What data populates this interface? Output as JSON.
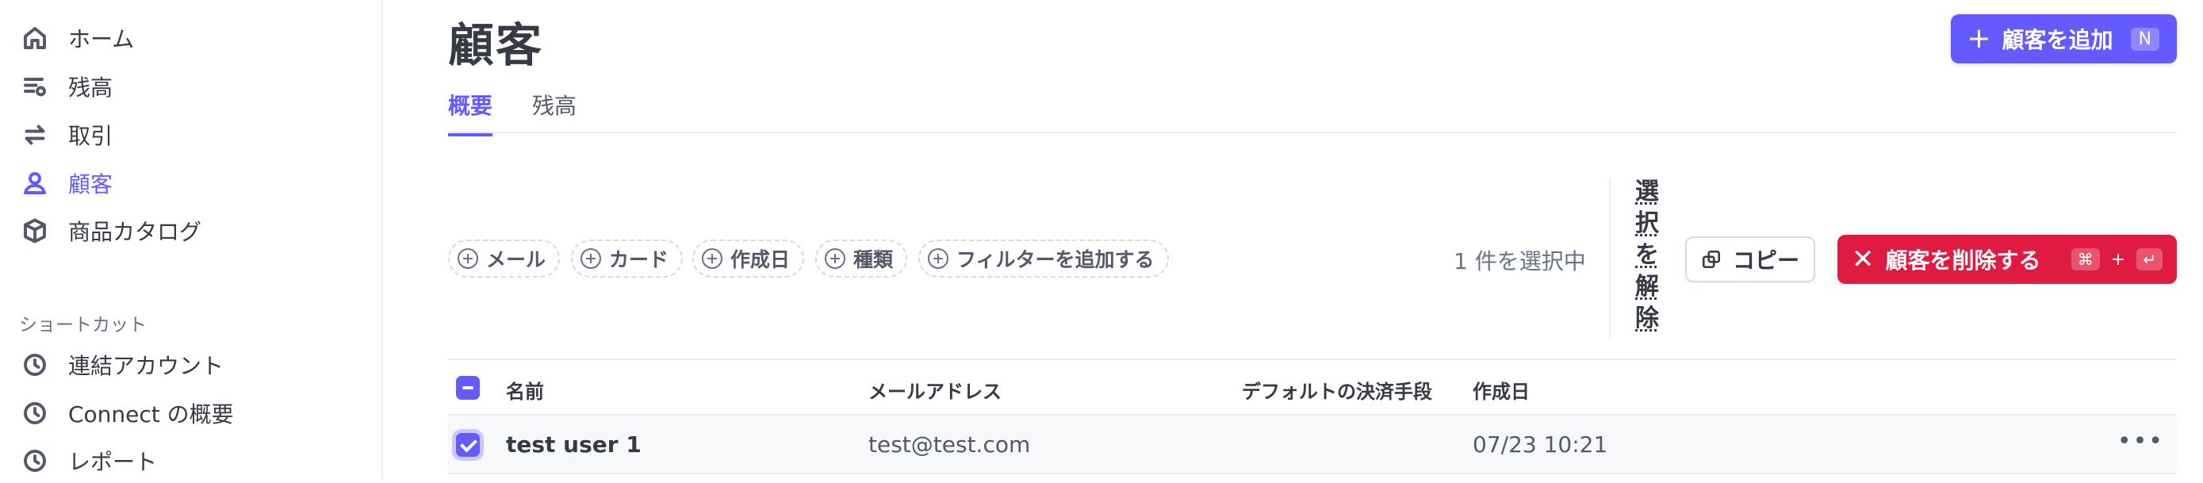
{
  "sidebar": {
    "items": [
      {
        "label": "ホーム",
        "icon": "home-icon"
      },
      {
        "label": "残高",
        "icon": "balance-icon"
      },
      {
        "label": "取引",
        "icon": "transfer-icon"
      },
      {
        "label": "顧客",
        "icon": "person-icon",
        "active": true
      },
      {
        "label": "商品カタログ",
        "icon": "box-icon"
      }
    ],
    "shortcuts_label": "ショートカット",
    "shortcuts": [
      {
        "label": "連結アカウント",
        "icon": "clock-icon"
      },
      {
        "label": "Connect の概要",
        "icon": "clock-icon"
      },
      {
        "label": "レポート",
        "icon": "clock-icon"
      }
    ]
  },
  "header": {
    "title": "顧客",
    "add_button": {
      "label": "顧客を追加",
      "shortcut": "N"
    }
  },
  "tabs": [
    {
      "label": "概要",
      "active": true
    },
    {
      "label": "残高",
      "active": false
    }
  ],
  "filters": [
    "メール",
    "カード",
    "作成日",
    "種類",
    "フィルターを追加する"
  ],
  "selection": {
    "count_text": "1 件を選択中",
    "deselect_label": "選択を解除",
    "copy_label": "コピー",
    "delete_label": "顧客を削除する",
    "delete_shortcut": [
      "⌘",
      "+",
      "↵"
    ]
  },
  "table": {
    "columns": [
      "名前",
      "メールアドレス",
      "デフォルトの決済手段",
      "作成日"
    ],
    "rows": [
      {
        "name": "test user 1",
        "email": "test@test.com",
        "payment": "",
        "created": "07/23 10:21",
        "selected": true
      }
    ]
  },
  "colors": {
    "accent": "#635bff",
    "danger": "#df1b41",
    "text": "#353a44",
    "muted": "#687385"
  }
}
